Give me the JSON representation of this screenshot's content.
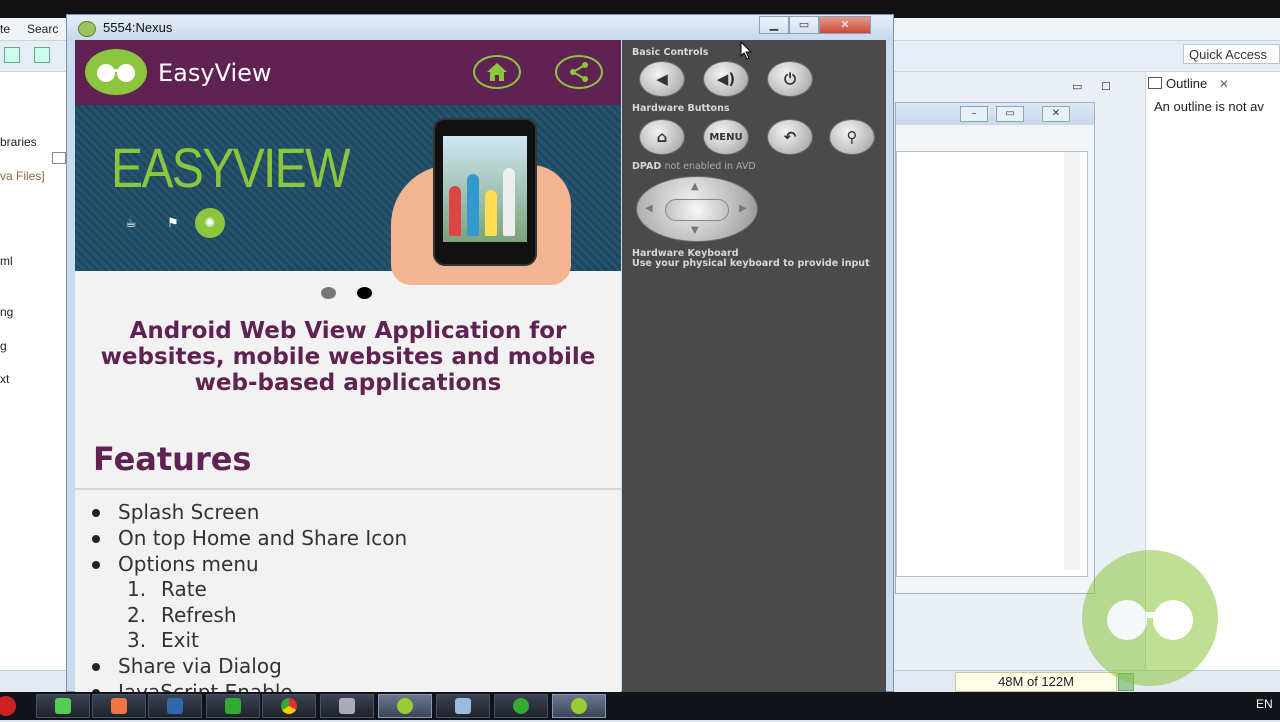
{
  "ide": {
    "menu_left_1": "te",
    "menu_left_2": "Searc",
    "quick_access": "Quick Access",
    "tree_items": [
      "braries",
      "va Files]",
      "ml",
      "ng",
      "g",
      "xt"
    ],
    "outline_tab": "Outline",
    "outline_message": "An outline is not av",
    "memory": "48M of 122M",
    "lang": "EN"
  },
  "emulator": {
    "window_title": "5554:Nexus",
    "controls": {
      "basic_controls": "Basic Controls",
      "hardware_buttons": "Hardware Buttons",
      "dpad_label": "DPAD",
      "dpad_note": "not enabled in AVD",
      "keyboard_label": "Hardware Keyboard",
      "keyboard_note": "Use your physical keyboard to provide input",
      "menu_button": "MENU"
    }
  },
  "app": {
    "title": "EasyView",
    "banner_text": "EASYVIEW",
    "headline": "Android Web View Application for websites, mobile websites and mobile web-based applications",
    "features_title": "Features",
    "features": [
      {
        "label": "Splash Screen"
      },
      {
        "label": "On top Home and Share Icon"
      },
      {
        "label": "Options menu"
      },
      {
        "label": "Rate",
        "num": "1."
      },
      {
        "label": "Refresh",
        "num": "2."
      },
      {
        "label": "Exit",
        "num": "3."
      },
      {
        "label": "Share via Dialog"
      },
      {
        "label": "JavaScript Enable"
      }
    ],
    "carousel": {
      "slides": 2,
      "active": 2
    }
  },
  "colors": {
    "brand_purple": "#5f2252",
    "brand_green": "#8cc63f",
    "banner_bg": "#1e4d66",
    "controls_bg": "#4a4a4a"
  }
}
